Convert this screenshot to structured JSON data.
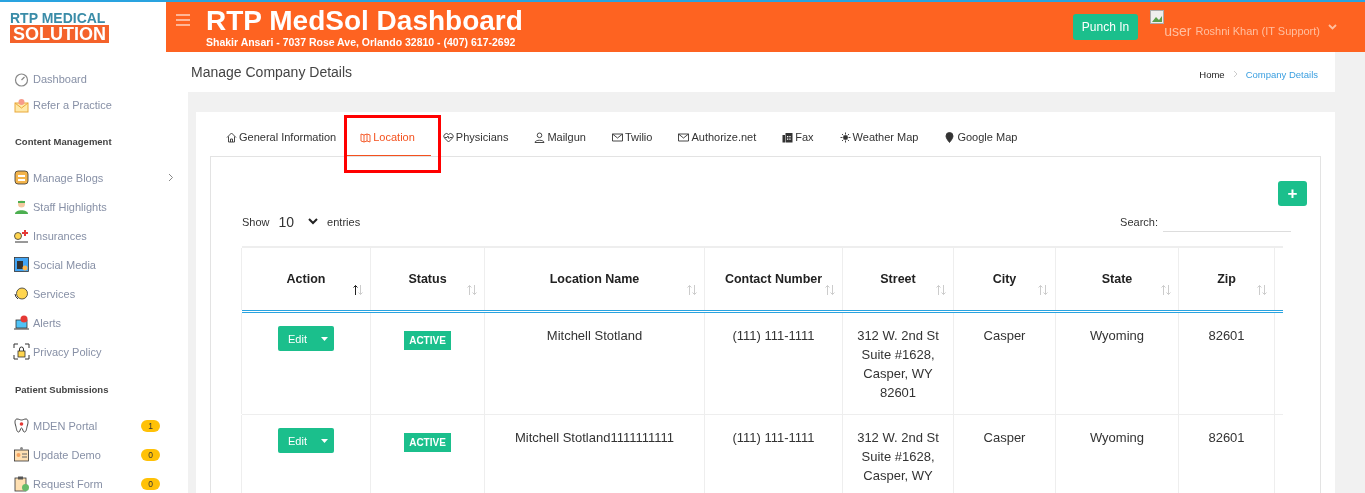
{
  "logo": {
    "line1": "RTP MEDICAL",
    "line2": "SOLUTION"
  },
  "header": {
    "title": "RTP MedSol Dashboard",
    "subtitle": "Shakir Ansari - 7037 Rose Ave, Orlando 32810 - (407) 617-2692",
    "punch_button": "Punch In",
    "user_alt": "user",
    "user_name": "Roshni Khan (IT Support)"
  },
  "page": {
    "title": "Manage Company Details",
    "breadcrumbs": [
      {
        "label": "Home",
        "selected": false
      },
      {
        "label": "Company Details",
        "selected": true
      }
    ]
  },
  "sidebar": {
    "sections": [
      {
        "items": [
          {
            "label": "Dashboard",
            "expandable": false
          },
          {
            "label": "Refer a Practice",
            "expandable": false
          }
        ]
      },
      {
        "heading": "Content Management",
        "items": [
          {
            "label": "Manage Blogs",
            "expandable": true
          },
          {
            "label": "Staff Highlights",
            "expandable": false
          },
          {
            "label": "Insurances",
            "expandable": false
          },
          {
            "label": "Social Media",
            "expandable": false
          },
          {
            "label": "Services",
            "expandable": false
          },
          {
            "label": "Alerts",
            "expandable": false
          },
          {
            "label": "Privacy Policy",
            "expandable": false
          }
        ]
      },
      {
        "heading": "Patient Submissions",
        "items": [
          {
            "label": "MDEN Portal",
            "expandable": false,
            "badge": "1"
          },
          {
            "label": "Update Demo",
            "expandable": false,
            "badge": "0"
          },
          {
            "label": "Request Form",
            "expandable": false,
            "badge": "0"
          }
        ]
      }
    ]
  },
  "tabs": [
    {
      "label": "General Information",
      "selected": false,
      "highlighted": false
    },
    {
      "label": "Location",
      "selected": true,
      "highlighted": true
    },
    {
      "label": "Physicians",
      "selected": false,
      "highlighted": false
    },
    {
      "label": "Mailgun",
      "selected": false,
      "highlighted": false
    },
    {
      "label": "Twilio",
      "selected": false,
      "highlighted": false
    },
    {
      "label": "Authorize.net",
      "selected": false,
      "highlighted": false
    },
    {
      "label": "Fax",
      "selected": false,
      "highlighted": false
    },
    {
      "label": "Weather Map",
      "selected": false,
      "highlighted": false
    },
    {
      "label": "Google Map",
      "selected": false,
      "highlighted": false
    }
  ],
  "table_controls": {
    "show_label": "Show",
    "entries_value": "10",
    "entries_label": "entries",
    "search_label": "Search:",
    "add_button": "+"
  },
  "table": {
    "columns": [
      {
        "label": "Action",
        "sorted": true
      },
      {
        "label": "Status",
        "sorted": false
      },
      {
        "label": "Location Name",
        "sorted": false
      },
      {
        "label": "Contact Number",
        "sorted": false
      },
      {
        "label": "Street",
        "sorted": false
      },
      {
        "label": "City",
        "sorted": false
      },
      {
        "label": "State",
        "sorted": false
      },
      {
        "label": "Zip",
        "sorted": false
      }
    ],
    "rows": [
      {
        "action": "Edit",
        "status": "ACTIVE",
        "location_name": "Mitchell Stotland",
        "contact": "(111) 111-1111",
        "street": "312 W. 2nd St Suite #1628, Casper, WY 82601",
        "city": "Casper",
        "state": "Wyoming",
        "zip": "82601"
      },
      {
        "action": "Edit",
        "status": "ACTIVE",
        "location_name": "Mitchell Stotland1111111111",
        "contact": "(111) 111-1111",
        "street": "312 W. 2nd St Suite #1628, Casper, WY",
        "city": "Casper",
        "state": "Wyoming",
        "zip": "82601"
      }
    ]
  }
}
